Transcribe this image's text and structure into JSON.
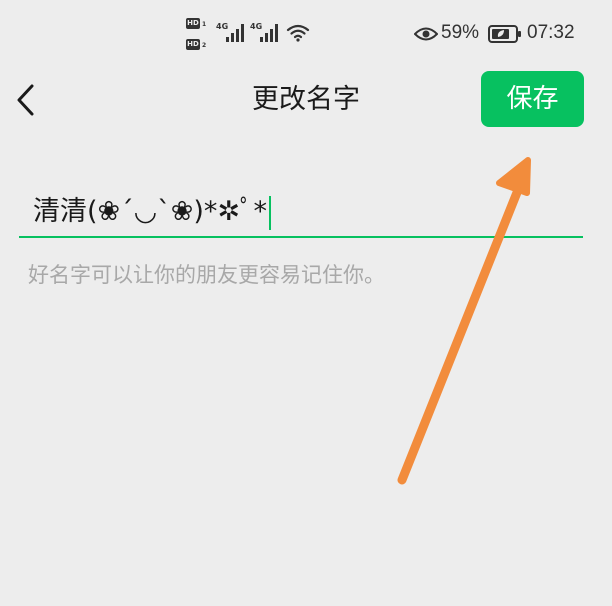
{
  "status_bar": {
    "hd1": "HD",
    "hd1_sub": "1",
    "hd2": "HD",
    "hd2_sub": "2",
    "net1": "4G",
    "net2": "4G",
    "battery_percent": "59%",
    "time": "07:32",
    "icons": [
      "eye-icon",
      "wifi-icon",
      "battery-icon",
      "signal-icon"
    ]
  },
  "header": {
    "back_icon": "chevron-left-icon",
    "title": "更改名字",
    "save_label": "保存"
  },
  "form": {
    "name_value": "清清(❀´◡`❀)*✲ﾟ*",
    "hint": "好名字可以让你的朋友更容易记住你。"
  },
  "colors": {
    "accent": "#07c160",
    "background": "#ededed",
    "annotation_arrow": "#f28c3c"
  }
}
